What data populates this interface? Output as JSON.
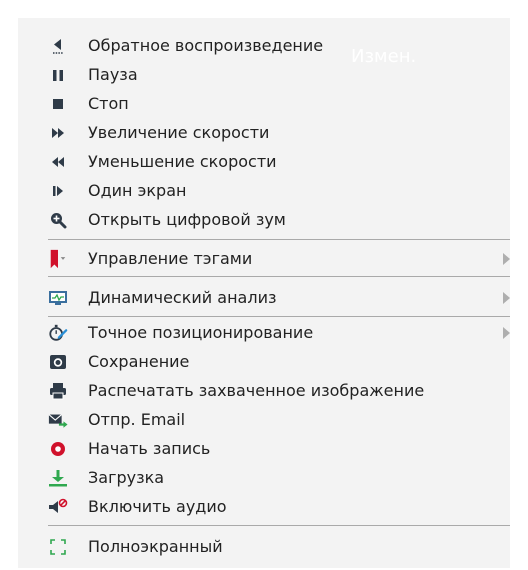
{
  "menu": {
    "overlay_text": "Измен.",
    "items": [
      {
        "label": "Обратное воспроизведение",
        "icon": "reverse-play-icon"
      },
      {
        "label": "Пауза",
        "icon": "pause-icon"
      },
      {
        "label": "Стоп",
        "icon": "stop-icon"
      },
      {
        "label": "Увеличение скорости",
        "icon": "fast-forward-icon"
      },
      {
        "label": "Уменьшение скорости",
        "icon": "rewind-icon"
      },
      {
        "label": "Один экран",
        "icon": "single-frame-icon"
      },
      {
        "label": "Открыть цифровой зум",
        "icon": "zoom-in-icon"
      },
      {
        "label": "Управление тэгами",
        "icon": "bookmark-tag-icon",
        "submenu": true
      },
      {
        "label": "Динамический анализ",
        "icon": "monitor-chart-icon",
        "submenu": true
      },
      {
        "label": "Точное позиционирование",
        "icon": "stopwatch-icon",
        "submenu": true
      },
      {
        "label": "Сохранение",
        "icon": "camera-icon"
      },
      {
        "label": "Распечатать захваченное изображение",
        "icon": "printer-icon"
      },
      {
        "label": "Отпр. Email",
        "icon": "email-send-icon"
      },
      {
        "label": "Начать запись",
        "icon": "record-icon"
      },
      {
        "label": "Загрузка",
        "icon": "download-icon"
      },
      {
        "label": "Включить аудио",
        "icon": "audio-muted-icon"
      },
      {
        "label": "Полноэкранный",
        "icon": "fullscreen-icon"
      }
    ]
  },
  "colors": {
    "menu_background": "#f3f3f3",
    "text": "#222222",
    "icon_dark": "#2f3b48",
    "tag_red": "#d0112b",
    "record_red": "#d0112b",
    "green": "#2fa84f",
    "monitor_blue": "#3a6f9e",
    "separator": "#a9a9a9",
    "submenu_arrow": "#aeaeae"
  }
}
